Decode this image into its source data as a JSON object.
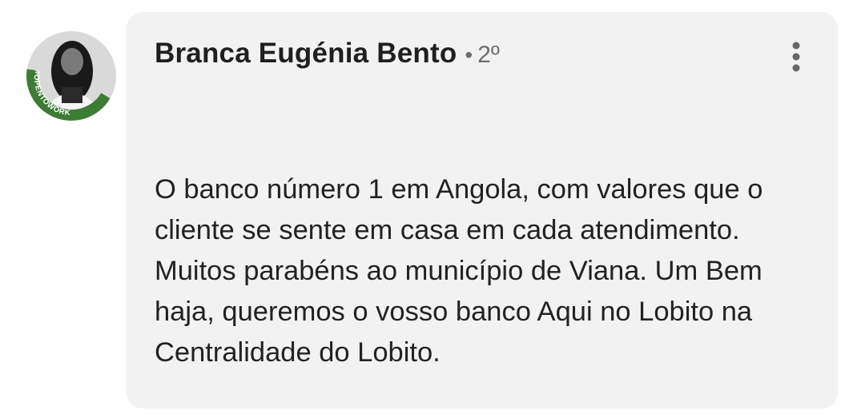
{
  "comment": {
    "author": {
      "name": "Branca Eugénia Bento",
      "separator": "•",
      "connection_degree": "2º",
      "avatar_badge": "#OPENTOWORK"
    },
    "more_options_icon": "vertical-ellipsis-icon",
    "text": "O banco número 1 em Angola, com valores que o cliente se sente em casa em cada atendimento. Muitos parabéns ao município de Viana. Um Bem haja, queremos o vosso banco Aqui no Lobito na Centralidade do Lobito."
  },
  "colors": {
    "card_background": "#f2f2f2",
    "open_to_work_green": "#3e7c36",
    "text_primary": "#1f1f1f",
    "text_secondary": "#6d6d6d"
  }
}
